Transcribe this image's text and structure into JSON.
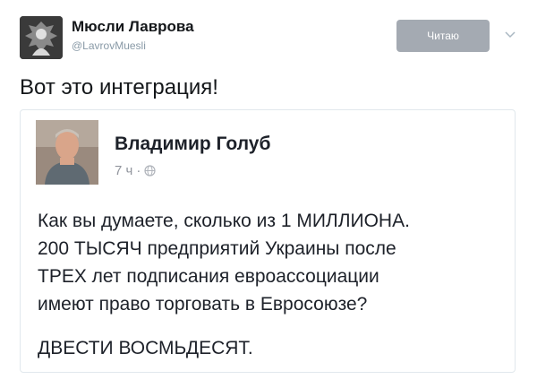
{
  "tweet": {
    "author_name": "Мюсли Лаврова",
    "author_handle": "@LavrovMuesli",
    "follow_label": "Читаю",
    "text": "Вот это интеграция!",
    "accent_color": "#a4aab2"
  },
  "quoted_post": {
    "author_name": "Владимир Голуб",
    "time": "7 ч",
    "separator": "·",
    "privacy_icon": "globe-icon",
    "body_lines": [
      "Как вы думаете, сколько из 1 МИЛЛИОНА.",
      "200 ТЫСЯЧ предприятий Украины после",
      "ТРЕХ лет подписания евроассоциации",
      "имеют право торговать в Евросоюзе?"
    ],
    "answer": "ДВЕСТИ ВОСМЬДЕСЯТ."
  }
}
